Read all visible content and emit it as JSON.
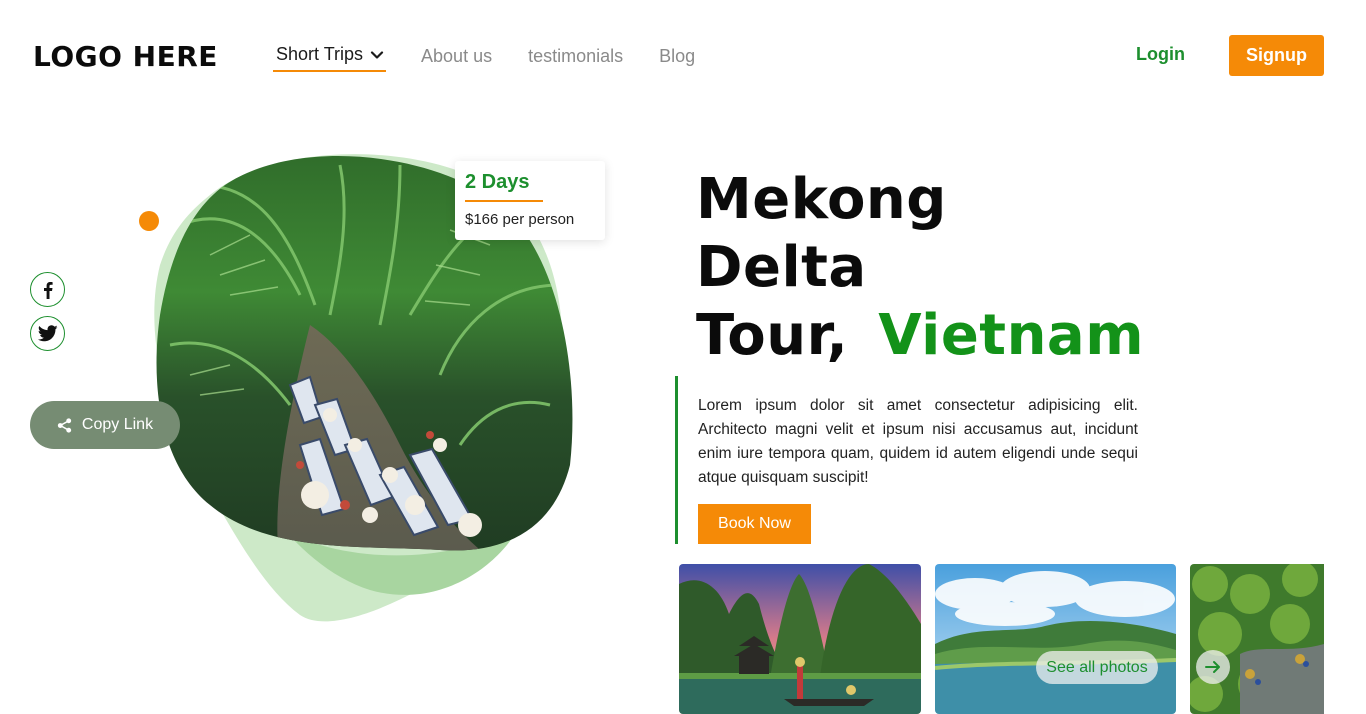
{
  "header": {
    "logo": "LOGO HERE",
    "nav": [
      {
        "label": "Short Trips",
        "active": true
      },
      {
        "label": "About us"
      },
      {
        "label": "testimonials"
      },
      {
        "label": "Blog"
      }
    ],
    "login_label": "Login",
    "signup_label": "Signup"
  },
  "hero": {
    "copy_link_label": "Copy Link",
    "price_card": {
      "days": "2 Days",
      "price": "$166 per person"
    },
    "title": {
      "line1": "Mekong",
      "line2": "Delta",
      "line3": "Tour,",
      "highlight": "Vietnam"
    },
    "description": "Lorem ipsum dolor sit amet consectetur adipisicing elit. Architecto magni velit et ipsum nisi accusamus aut, incidunt enim iure tempora quam, quidem id autem eligendi unde sequi atque quisquam suscipit!",
    "book_label": "Book Now"
  },
  "gallery": {
    "see_all_label": "See all photos"
  },
  "colors": {
    "accent_orange": "#f58a07",
    "brand_green": "#1d8f2e",
    "title_green": "#139219",
    "copy_link_bg": "#768c73"
  },
  "icons": [
    "chevron-down-icon",
    "facebook-icon",
    "twitter-icon",
    "share-icon",
    "arrow-right-icon"
  ]
}
